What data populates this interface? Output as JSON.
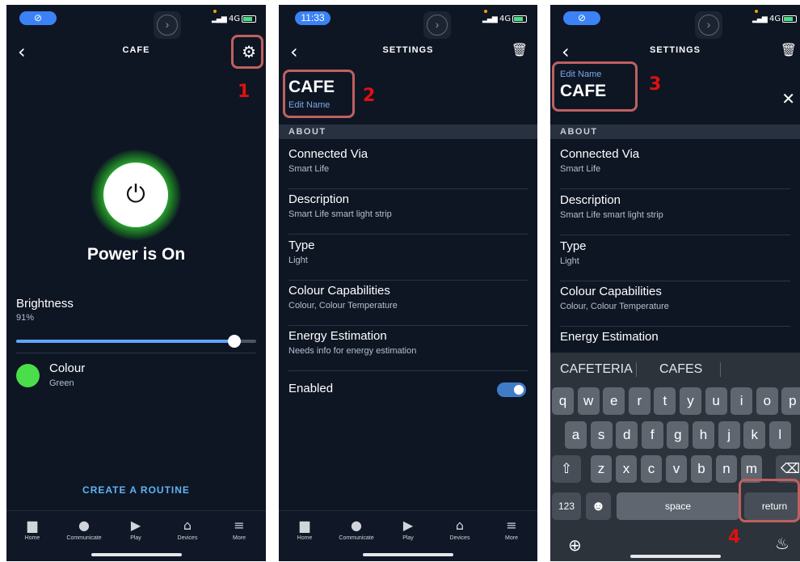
{
  "status": {
    "time": "11:33",
    "network": "4G"
  },
  "screen1": {
    "header_title": "CAFE",
    "power_text": "Power is On",
    "brightness_label": "Brightness",
    "brightness_value": "91%",
    "brightness_level": 0.91,
    "colour_label": "Colour",
    "colour_value": "Green",
    "colour_hex": "#4ade4a",
    "routine_label": "CREATE A ROUTINE",
    "annotation": "1"
  },
  "screen2": {
    "header_title": "SETTINGS",
    "name": "CAFE",
    "edit_name": "Edit Name",
    "about": "ABOUT",
    "rows": [
      {
        "title": "Connected Via",
        "sub": "Smart Life"
      },
      {
        "title": "Description",
        "sub": "Smart Life smart light strip"
      },
      {
        "title": "Type",
        "sub": "Light"
      },
      {
        "title": "Colour Capabilities",
        "sub": "Colour, Colour Temperature"
      },
      {
        "title": "Energy Estimation",
        "sub": "Needs info for energy estimation"
      }
    ],
    "enabled_label": "Enabled",
    "enabled": true,
    "annotation": "2"
  },
  "screen3": {
    "header_title": "SETTINGS",
    "edit_name": "Edit Name",
    "name": "CAFE",
    "about": "ABOUT",
    "rows": [
      {
        "title": "Connected Via",
        "sub": "Smart Life"
      },
      {
        "title": "Description",
        "sub": "Smart Life smart light strip"
      },
      {
        "title": "Type",
        "sub": "Light"
      },
      {
        "title": "Colour Capabilities",
        "sub": "Colour, Colour Temperature"
      },
      {
        "title": "Energy Estimation",
        "sub": ""
      }
    ],
    "suggestions": [
      "CAFETERIA",
      "CAFES"
    ],
    "keys_row1": [
      "q",
      "w",
      "e",
      "r",
      "t",
      "y",
      "u",
      "i",
      "o",
      "p"
    ],
    "keys_row2": [
      "a",
      "s",
      "d",
      "f",
      "g",
      "h",
      "j",
      "k",
      "l"
    ],
    "keys_row3": [
      "z",
      "x",
      "c",
      "v",
      "b",
      "n",
      "m"
    ],
    "key_numbers": "123",
    "key_space": "space",
    "key_return": "return",
    "annotation_name": "3",
    "annotation_return": "4"
  },
  "bottom_nav": [
    {
      "label": "Home",
      "icon": "home-icon"
    },
    {
      "label": "Communicate",
      "icon": "chat-icon"
    },
    {
      "label": "Play",
      "icon": "play-icon"
    },
    {
      "label": "Devices",
      "icon": "devices-icon"
    },
    {
      "label": "More",
      "icon": "menu-icon"
    }
  ]
}
